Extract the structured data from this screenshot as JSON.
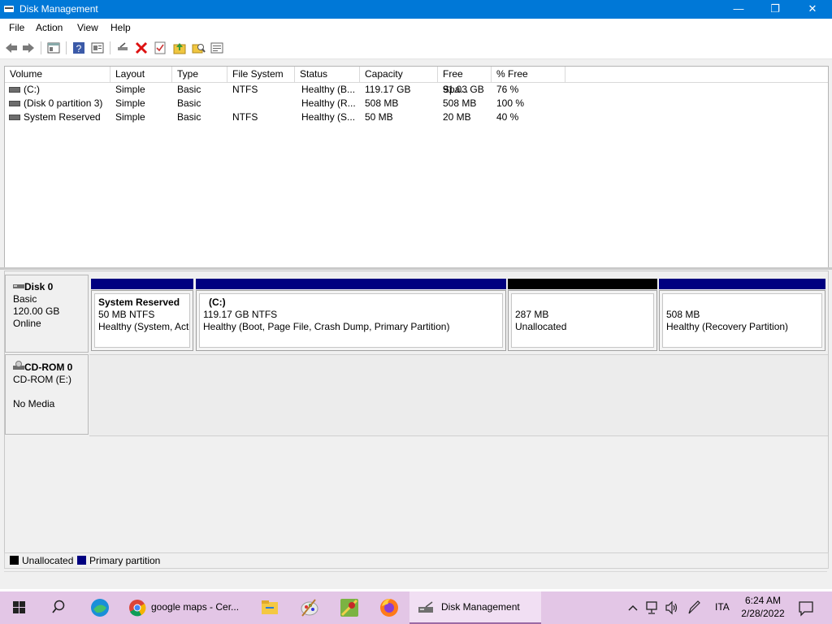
{
  "window": {
    "title": "Disk Management",
    "app_icon": "disk-management-icon",
    "controls": [
      "minimize-icon",
      "maximize-icon",
      "close-icon"
    ]
  },
  "menu": {
    "items": [
      "File",
      "Action",
      "View",
      "Help"
    ]
  },
  "toolbar": {
    "icons": [
      "back-arrow-icon",
      "forward-arrow-icon",
      "show-hide-console-tree-icon",
      "help-icon",
      "properties-icon",
      "connect-drive-icon",
      "delete-icon",
      "checklist-icon",
      "folder-up-icon",
      "search-folder-icon",
      "settings-list-icon"
    ]
  },
  "volume_list": {
    "columns": [
      "Volume",
      "Layout",
      "Type",
      "File System",
      "Status",
      "Capacity",
      "Free Spa...",
      "% Free"
    ],
    "rows": [
      {
        "volume": "(C:)",
        "layout": "Simple",
        "type": "Basic",
        "fs": "NTFS",
        "status": "Healthy (B...",
        "capacity": "119.17 GB",
        "free": "91.03 GB",
        "pct": "76 %"
      },
      {
        "volume": "(Disk 0 partition 3)",
        "layout": "Simple",
        "type": "Basic",
        "fs": "",
        "status": "Healthy (R...",
        "capacity": "508 MB",
        "free": "508 MB",
        "pct": "100 %"
      },
      {
        "volume": "System Reserved",
        "layout": "Simple",
        "type": "Basic",
        "fs": "NTFS",
        "status": "Healthy (S...",
        "capacity": "50 MB",
        "free": "20 MB",
        "pct": "40 %"
      }
    ]
  },
  "disks": [
    {
      "name": "Disk 0",
      "line1": "Basic",
      "line2": "120.00 GB",
      "line3": "Online",
      "partitions": [
        {
          "title": "System Reserved",
          "size": "50 MB NTFS",
          "status": "Healthy (System, Acti",
          "kind": "primary"
        },
        {
          "title": "(C:)",
          "size": "119.17 GB NTFS",
          "status": "Healthy (Boot, Page File, Crash Dump, Primary Partition)",
          "kind": "primary"
        },
        {
          "title": "",
          "size": "287 MB",
          "status": "Unallocated",
          "kind": "unallocated"
        },
        {
          "title": "",
          "size": "508 MB",
          "status": "Healthy (Recovery Partition)",
          "kind": "primary"
        }
      ]
    },
    {
      "name": "CD-ROM 0",
      "line1": "CD-ROM (E:)",
      "line2": "",
      "line3": "No Media"
    }
  ],
  "legend": [
    {
      "label": "Unallocated",
      "color": "#000000"
    },
    {
      "label": "Primary partition",
      "color": "#000080"
    }
  ],
  "taskbar": {
    "apps": [
      "start-icon",
      "search-icon",
      "edge-icon",
      "chrome-icon",
      "file-explorer-icon",
      "paint-icon",
      "maps-app-icon",
      "firefox-icon"
    ],
    "chrome_label": "google maps - Cer...",
    "active_label": "Disk Management",
    "language": "ITA",
    "time": "6:24 AM",
    "date": "2/28/2022",
    "tray_icons": [
      "chevron-up-icon",
      "network-icon",
      "volume-icon",
      "pen-icon",
      "notification-icon"
    ]
  },
  "colors": {
    "titlebar": "#0078d7",
    "primary": "#000080",
    "unallocated": "#000000",
    "taskbar": "#e3c6e6"
  }
}
